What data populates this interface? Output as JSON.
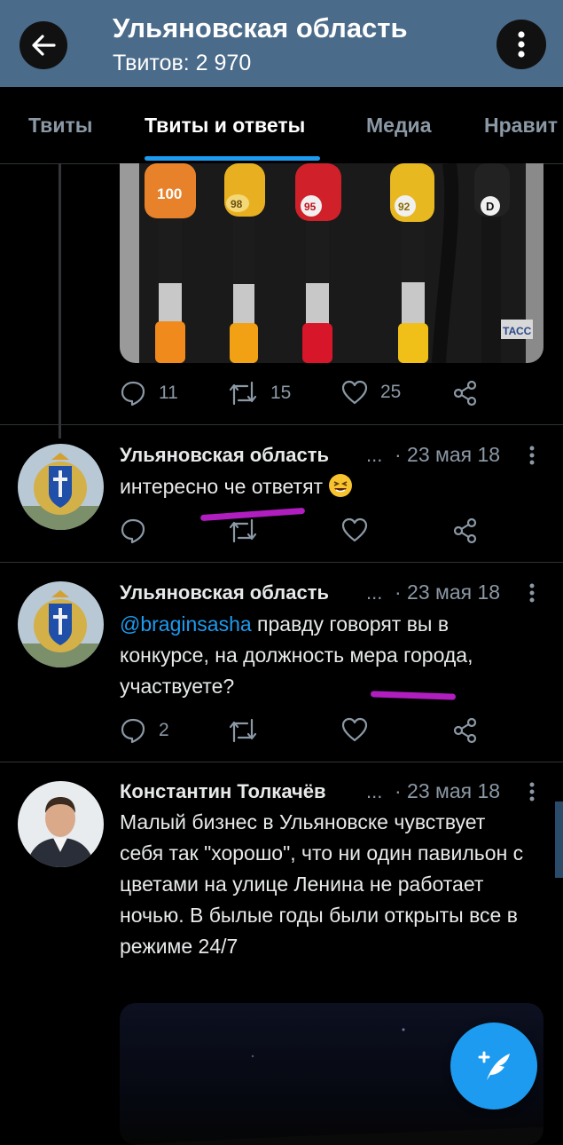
{
  "header": {
    "title": "Ульяновская область",
    "subtitle": "Твитов: 2 970"
  },
  "tabs": [
    {
      "label": "Твиты"
    },
    {
      "label": "Твиты и ответы"
    },
    {
      "label": "Медиа"
    },
    {
      "label": "Нравит"
    }
  ],
  "photo": {
    "watermark": "ТАСС",
    "nozzles": [
      "100",
      "98",
      "95",
      "92",
      "D"
    ]
  },
  "tweet0_actions": {
    "replies": "11",
    "retweets": "15",
    "likes": "25"
  },
  "tweets": [
    {
      "name": "Ульяновская область",
      "dots": "...",
      "date": "· 23 мая 18",
      "text": "интересно че ответят",
      "emoji": "laughing-face"
    },
    {
      "name": "Ульяновская область",
      "dots": "...",
      "date": "· 23 мая 18",
      "mention": "@braginsasha",
      "text": " правду говорят вы в конкурсе, на должность мера города, участвуете?",
      "replies": "2"
    },
    {
      "name": "Константин Толкачёв",
      "dots": "...",
      "date": "· 23 мая 18",
      "text": "Малый бизнес в Ульяновске чувствует себя так \"хорошо\", что ни один павильон с цветами на улице Ленина не работает ночью. В былые годы были открыты все в режиме 24/7"
    }
  ],
  "colors": {
    "accent": "#1d9bf0",
    "header": "#4a6b8a",
    "annotation": "#b01ec0",
    "background": "#000000"
  }
}
